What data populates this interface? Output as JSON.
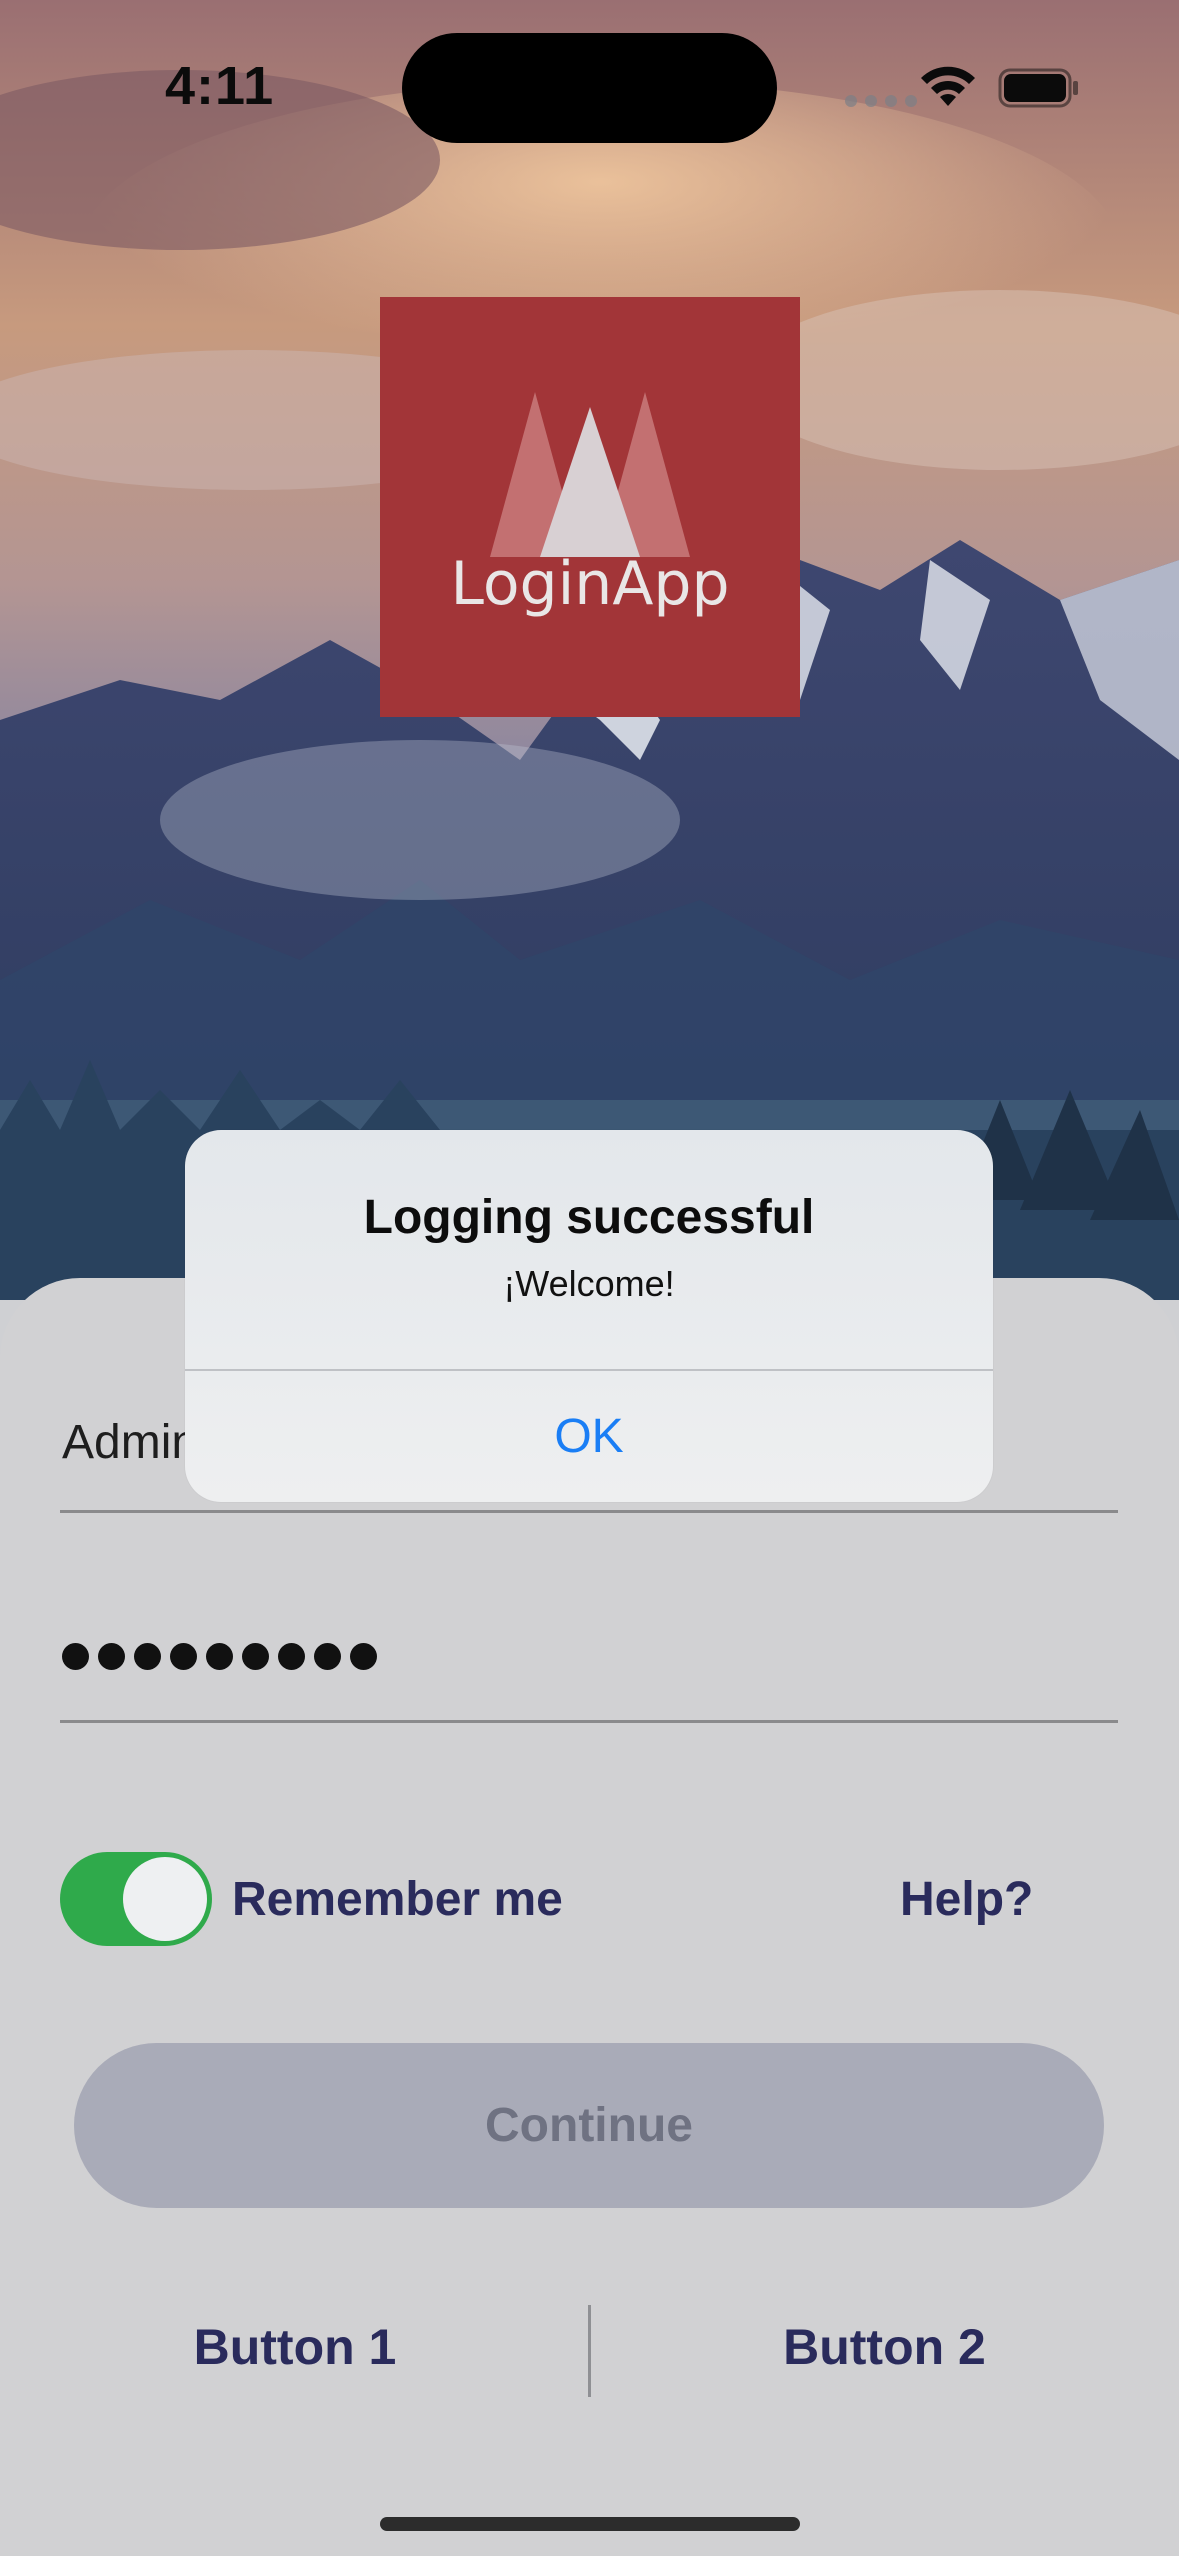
{
  "status_bar": {
    "time": "4:11"
  },
  "logo": {
    "text": "LoginApp"
  },
  "form": {
    "username_value": "Admin",
    "password_dots": 9,
    "remember_label": "Remember me",
    "remember_on": true,
    "help_label": "Help?",
    "continue_label": "Continue",
    "button1_label": "Button 1",
    "button2_label": "Button 2"
  },
  "alert": {
    "title": "Logging successful",
    "message": "¡Welcome!",
    "ok_label": "OK"
  },
  "colors": {
    "logo_bg": "#a23538",
    "toggle_on": "#2faa4b",
    "link_text": "#2a2b5c",
    "alert_button": "#1a7ef5"
  }
}
